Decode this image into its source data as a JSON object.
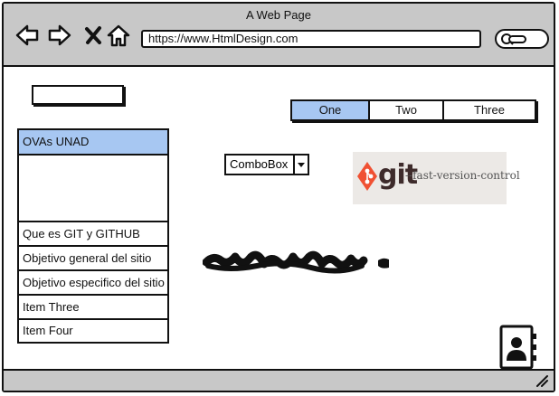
{
  "browser": {
    "title": "A Web Page",
    "url": "https://www.HtmlDesign.com",
    "nav_icons": [
      "back-arrow-icon",
      "forward-arrow-icon",
      "close-x-icon",
      "home-icon",
      "search-icon"
    ]
  },
  "tabs": {
    "items": [
      "One",
      "Two",
      "Three"
    ],
    "active": "One"
  },
  "menu": {
    "selected": "OVAs  UNAD",
    "items": [
      "OVAs  UNAD",
      "Que es GIT y GITHUB",
      "Objetivo general del sitio",
      "Objetivo especifico del sitio",
      "Item Three",
      "Item Four"
    ]
  },
  "combo": {
    "value": "ComboBox"
  },
  "git_logo": {
    "word": "git",
    "tagline": "--fast-version-control",
    "accent": "#f05133"
  },
  "colors": {
    "chrome": "#c8c8c8",
    "selection": "#a7c7f2",
    "ink": "#111111"
  }
}
